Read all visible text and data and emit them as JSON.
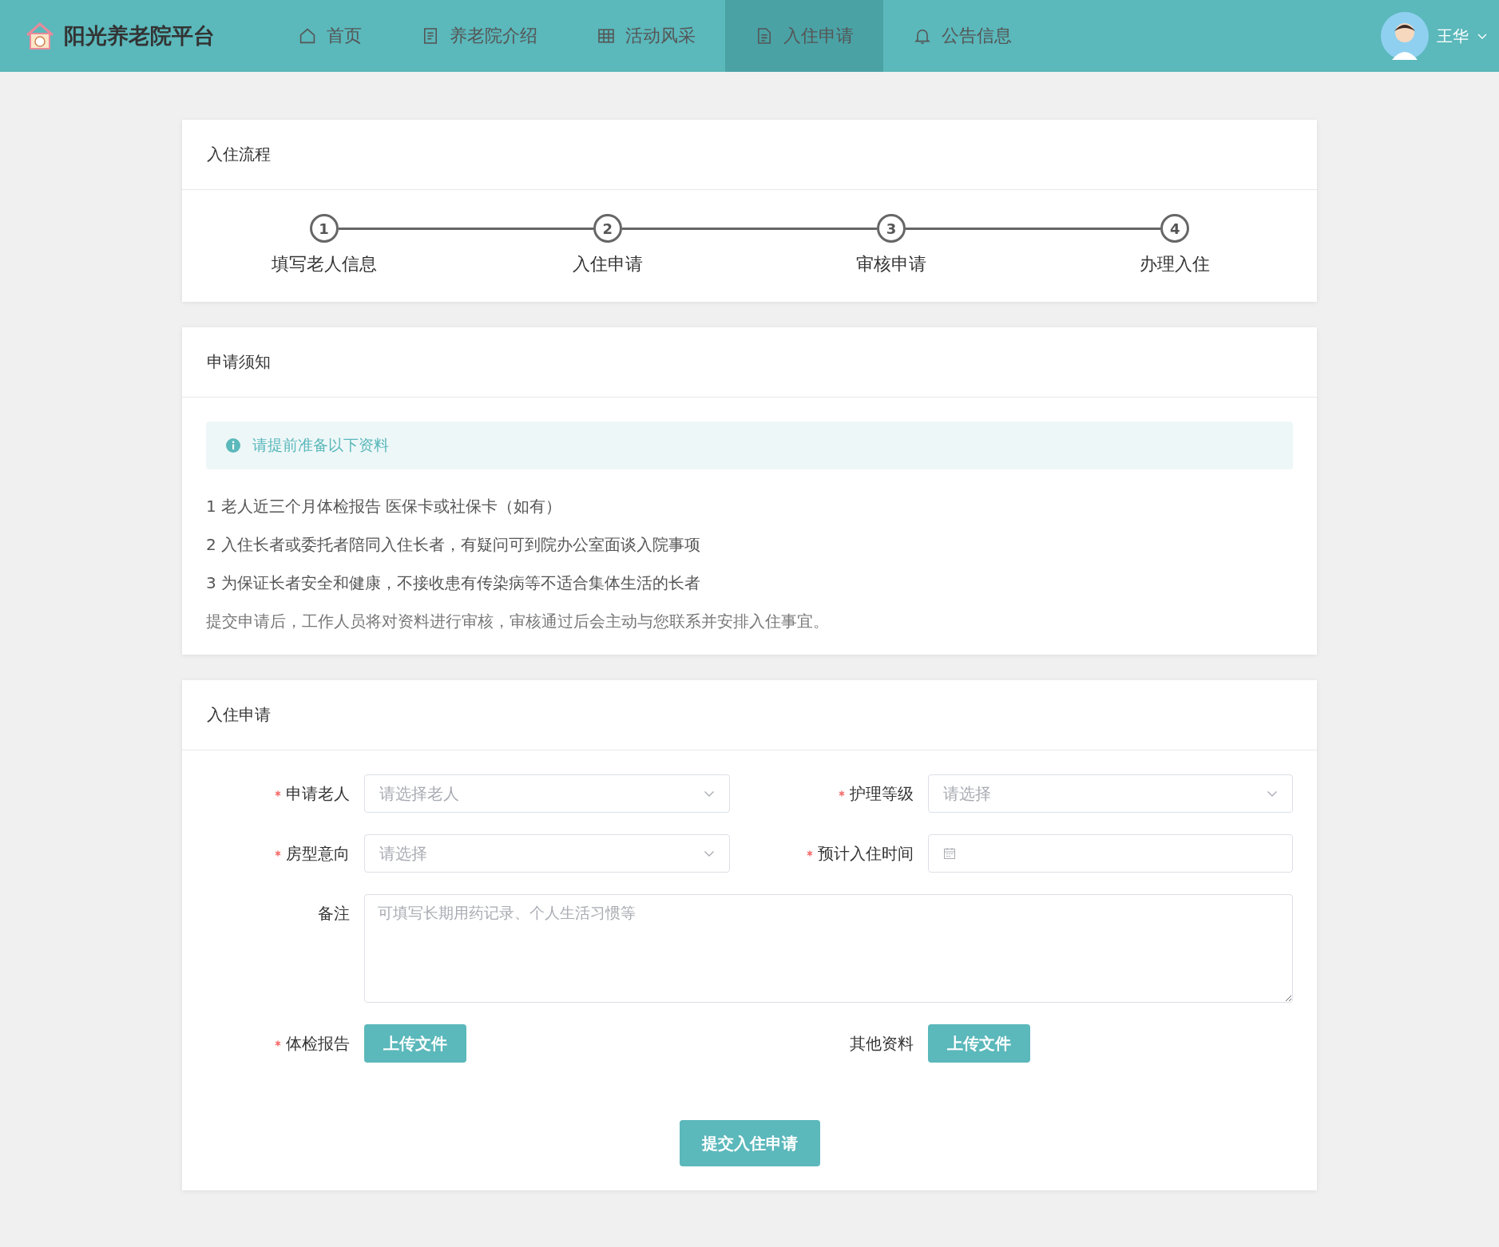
{
  "header": {
    "brand": "阳光养老院平台",
    "nav": [
      {
        "label": "首页",
        "kind": "home",
        "selected": false
      },
      {
        "label": "养老院介绍",
        "kind": "doc",
        "selected": false
      },
      {
        "label": "活动风采",
        "kind": "grid",
        "selected": false
      },
      {
        "label": "入住申请",
        "kind": "file",
        "selected": true
      },
      {
        "label": "公告信息",
        "kind": "bell",
        "selected": false
      }
    ],
    "user": {
      "name": "王华"
    }
  },
  "process": {
    "title": "入住流程",
    "steps": [
      {
        "number": "1",
        "label": "填写老人信息"
      },
      {
        "number": "2",
        "label": "入住申请"
      },
      {
        "number": "3",
        "label": "审核申请"
      },
      {
        "number": "4",
        "label": "办理入住"
      }
    ]
  },
  "notice": {
    "title": "申请须知",
    "alert": "请提前准备以下资料",
    "lines": [
      "1 老人近三个月体检报告 医保卡或社保卡（如有）",
      "2 入住长者或委托者陪同入住长者，有疑问可到院办公室面谈入院事项",
      "3 为保证长者安全和健康，不接收患有传染病等不适合集体生活的长者",
      "提交申请后，工作人员将对资料进行审核，审核通过后会主动与您联系并安排入住事宜。"
    ]
  },
  "application": {
    "title": "入住申请",
    "fields": [
      {
        "kind": "select",
        "label": "申请老人",
        "required": true,
        "placeholder": "请选择老人"
      },
      {
        "kind": "select",
        "label": "护理等级",
        "required": true,
        "placeholder": "请选择"
      },
      {
        "kind": "select",
        "label": "房型意向",
        "required": true,
        "placeholder": "请选择"
      },
      {
        "kind": "date",
        "label": "预计入住时间",
        "required": true
      },
      {
        "kind": "textarea",
        "label": "备注",
        "required": false,
        "placeholder": "可填写长期用药记录、个人生活习惯等"
      },
      {
        "kind": "upload",
        "label": "体检报告",
        "required": true,
        "button": "上传文件"
      },
      {
        "kind": "upload",
        "label": "其他资料",
        "required": false,
        "button": "上传文件"
      }
    ],
    "submit": "提交入住申请"
  }
}
